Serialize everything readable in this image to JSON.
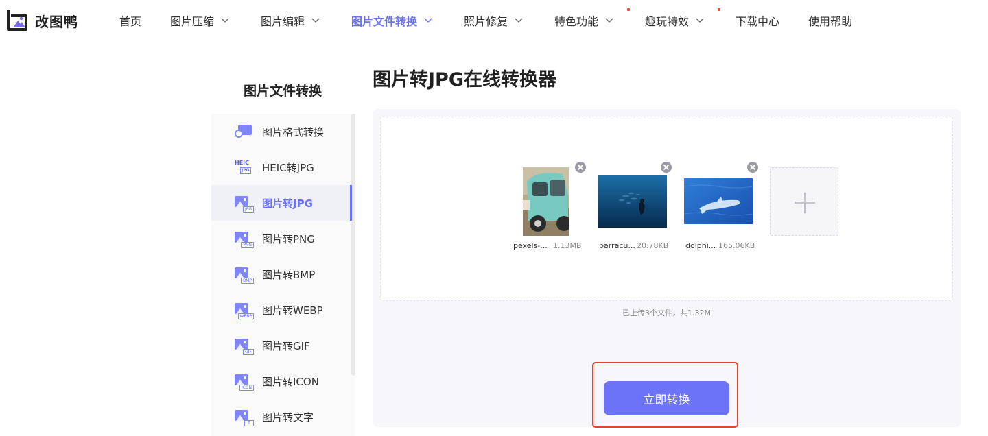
{
  "logo": {
    "text": "改图鸭"
  },
  "nav": {
    "items": [
      {
        "label": "首页"
      },
      {
        "label": "图片压缩"
      },
      {
        "label": "图片编辑"
      },
      {
        "label": "图片文件转换"
      },
      {
        "label": "照片修复"
      },
      {
        "label": "特色功能"
      },
      {
        "label": "趣玩特效"
      },
      {
        "label": "下载中心"
      },
      {
        "label": "使用帮助"
      }
    ],
    "active_index": 3,
    "accent_color": "#6b72f6"
  },
  "sidebar": {
    "title": "图片文件转换",
    "active_index": 2,
    "items": [
      {
        "label": "图片格式转换",
        "icon": "format-convert-icon"
      },
      {
        "label": "HEIC转JPG",
        "icon": "heic-icon",
        "icon_text_top": "HEIC",
        "icon_text_tag": "JPG"
      },
      {
        "label": "图片转JPG",
        "icon": "jpg-icon",
        "tag": "JPG"
      },
      {
        "label": "图片转PNG",
        "icon": "png-icon",
        "tag": "PNG"
      },
      {
        "label": "图片转BMP",
        "icon": "bmp-icon",
        "tag": "BMP"
      },
      {
        "label": "图片转WEBP",
        "icon": "webp-icon",
        "tag": "WEBP"
      },
      {
        "label": "图片转GIF",
        "icon": "gif-icon",
        "tag": "GIF"
      },
      {
        "label": "图片转ICON",
        "icon": "icon-format-icon",
        "tag": "ICON"
      },
      {
        "label": "图片转文字",
        "icon": "text-icon",
        "tag": "T"
      }
    ]
  },
  "main": {
    "title": "图片转JPG在线转换器",
    "files": [
      {
        "name": "pexels-...",
        "size": "1.13MB"
      },
      {
        "name": "barracu...",
        "size": "20.78KB"
      },
      {
        "name": "dolphi...",
        "size": "165.06KB"
      }
    ],
    "summary": "已上传3个文件，共1.32M",
    "convert_button": "立即转换",
    "button_color": "#6d73f6",
    "highlight_color": "#e4432f"
  }
}
